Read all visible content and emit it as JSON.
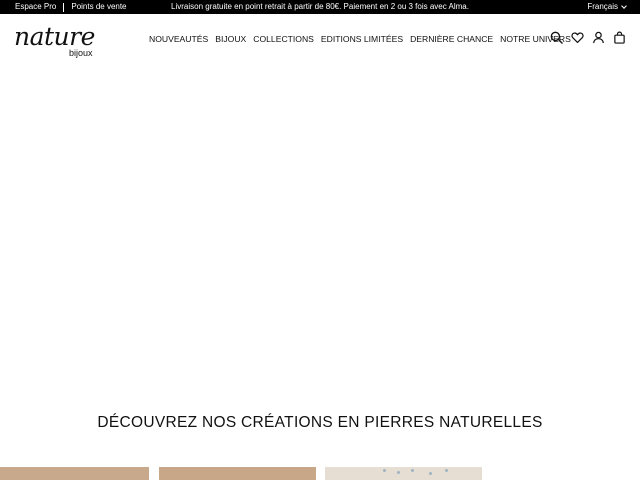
{
  "topbar": {
    "links": [
      "Espace Pro",
      "Points de vente"
    ],
    "promo": "Livraison gratuite en point retrait à partir de 80€. Paiement en 2 ou 3 fois avec Alma.",
    "language": "Français"
  },
  "logo": {
    "main": "nature",
    "sub": "bijoux"
  },
  "nav": {
    "items": [
      "NOUVEAUTÉS",
      "BIJOUX",
      "COLLECTIONS",
      "EDITIONS LIMITÉES",
      "DERNIÈRE CHANCE",
      "NOTRE UNIVERS"
    ]
  },
  "icons": [
    "search-icon",
    "heart-icon",
    "account-icon",
    "bag-icon"
  ],
  "section": {
    "title": "DÉCOUVREZ NOS CRÉATIONS EN PIERRES NATURELLES"
  },
  "colors": {
    "topbar_bg": "#000000",
    "thumb_warm": "#c9a98c",
    "thumb_light": "#e6ddd3"
  }
}
